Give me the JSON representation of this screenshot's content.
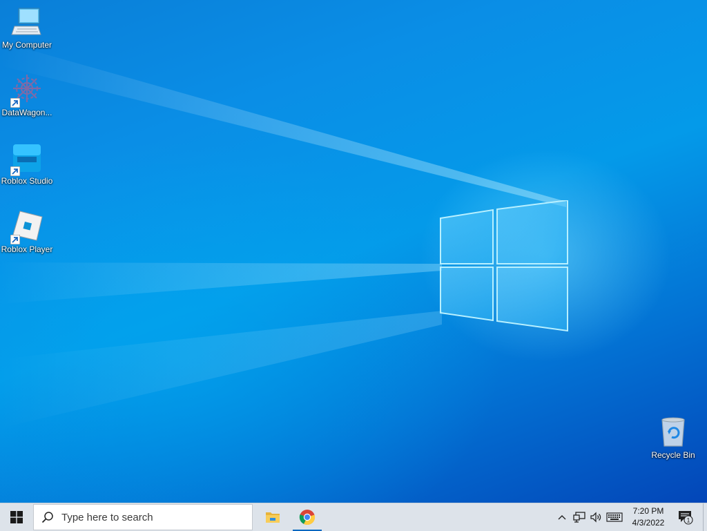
{
  "desktop_icons": [
    {
      "label": "My Computer",
      "icon": "computer-icon"
    },
    {
      "label": "DataWagon...",
      "icon": "datawagon-icon",
      "shortcut": true
    },
    {
      "label": "Roblox Studio",
      "icon": "roblox-studio-icon",
      "shortcut": true
    },
    {
      "label": "Roblox Player",
      "icon": "roblox-player-icon",
      "shortcut": true
    },
    {
      "label": "Recycle Bin",
      "icon": "recycle-bin-icon"
    }
  ],
  "taskbar": {
    "search_placeholder": "Type here to search",
    "pinned": [
      "file-explorer-icon",
      "chrome-icon"
    ],
    "active_app": "chrome-icon"
  },
  "tray": {
    "time": "7:20 PM",
    "date": "4/3/2022",
    "notification_count": "1",
    "icons": [
      "chevron-up-icon",
      "network-icon",
      "volume-icon",
      "keyboard-icon"
    ]
  },
  "colors": {
    "wallpaper_blue": "#0a8ee6",
    "taskbar_bg": "#dde3ea",
    "accent": "#0067c0"
  }
}
